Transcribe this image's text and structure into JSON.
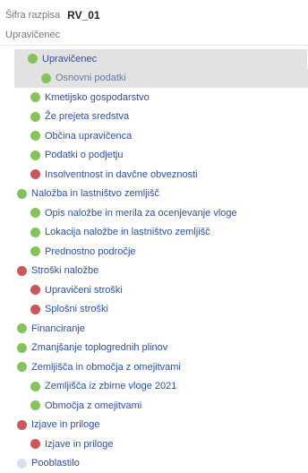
{
  "header": {
    "label": "Šifra razpisa",
    "value": "RV_01"
  },
  "subheader": "Upravičenec",
  "colors": {
    "green": "#84c35a",
    "red": "#c9575b",
    "gray": "#d8deed",
    "link": "#2b50a6",
    "selected_bg": "#e2e2e2"
  },
  "tree": [
    {
      "label": "Upravičenec",
      "status": "green",
      "level": 0,
      "state": "selected"
    },
    {
      "label": "Osnovni podatki",
      "status": "green",
      "level": 1,
      "state": "selected-child"
    },
    {
      "label": "Kmetijsko gospodarstvo",
      "status": "green",
      "level": 1
    },
    {
      "label": "Že prejeta sredstva",
      "status": "green",
      "level": 1
    },
    {
      "label": "Občina upravičenca",
      "status": "green",
      "level": 1
    },
    {
      "label": "Podatki o podjetju",
      "status": "green",
      "level": 1
    },
    {
      "label": "Insolventnost in davčne obveznosti",
      "status": "red",
      "level": 1
    },
    {
      "label": "Naložba in lastništvo zemljišč",
      "status": "green",
      "level": 0
    },
    {
      "label": "Opis naložbe in merila za ocenjevanje vloge",
      "status": "green",
      "level": 1
    },
    {
      "label": "Lokacija naložbe in lastništvo zemljišč",
      "status": "green",
      "level": 1
    },
    {
      "label": "Prednostno področje",
      "status": "green",
      "level": 1
    },
    {
      "label": "Stroški naložbe",
      "status": "red",
      "level": 0
    },
    {
      "label": "Upravičeni stroški",
      "status": "red",
      "level": 1
    },
    {
      "label": "Splošni stroški",
      "status": "red",
      "level": 1
    },
    {
      "label": "Financiranje",
      "status": "green",
      "level": 0
    },
    {
      "label": "Zmanjšanje toplogrednih plinov",
      "status": "green",
      "level": 0
    },
    {
      "label": "Zemljišča in območja z omejitvami",
      "status": "green",
      "level": 0
    },
    {
      "label": "Zemljišča iz zbirne vloge 2021",
      "status": "green",
      "level": 1
    },
    {
      "label": "Območja z omejitvami",
      "status": "green",
      "level": 1
    },
    {
      "label": "Izjave in priloge",
      "status": "red",
      "level": 0
    },
    {
      "label": "Izjave in priloge",
      "status": "red",
      "level": 1
    },
    {
      "label": "Pooblastilo",
      "status": "gray",
      "level": 0
    }
  ]
}
